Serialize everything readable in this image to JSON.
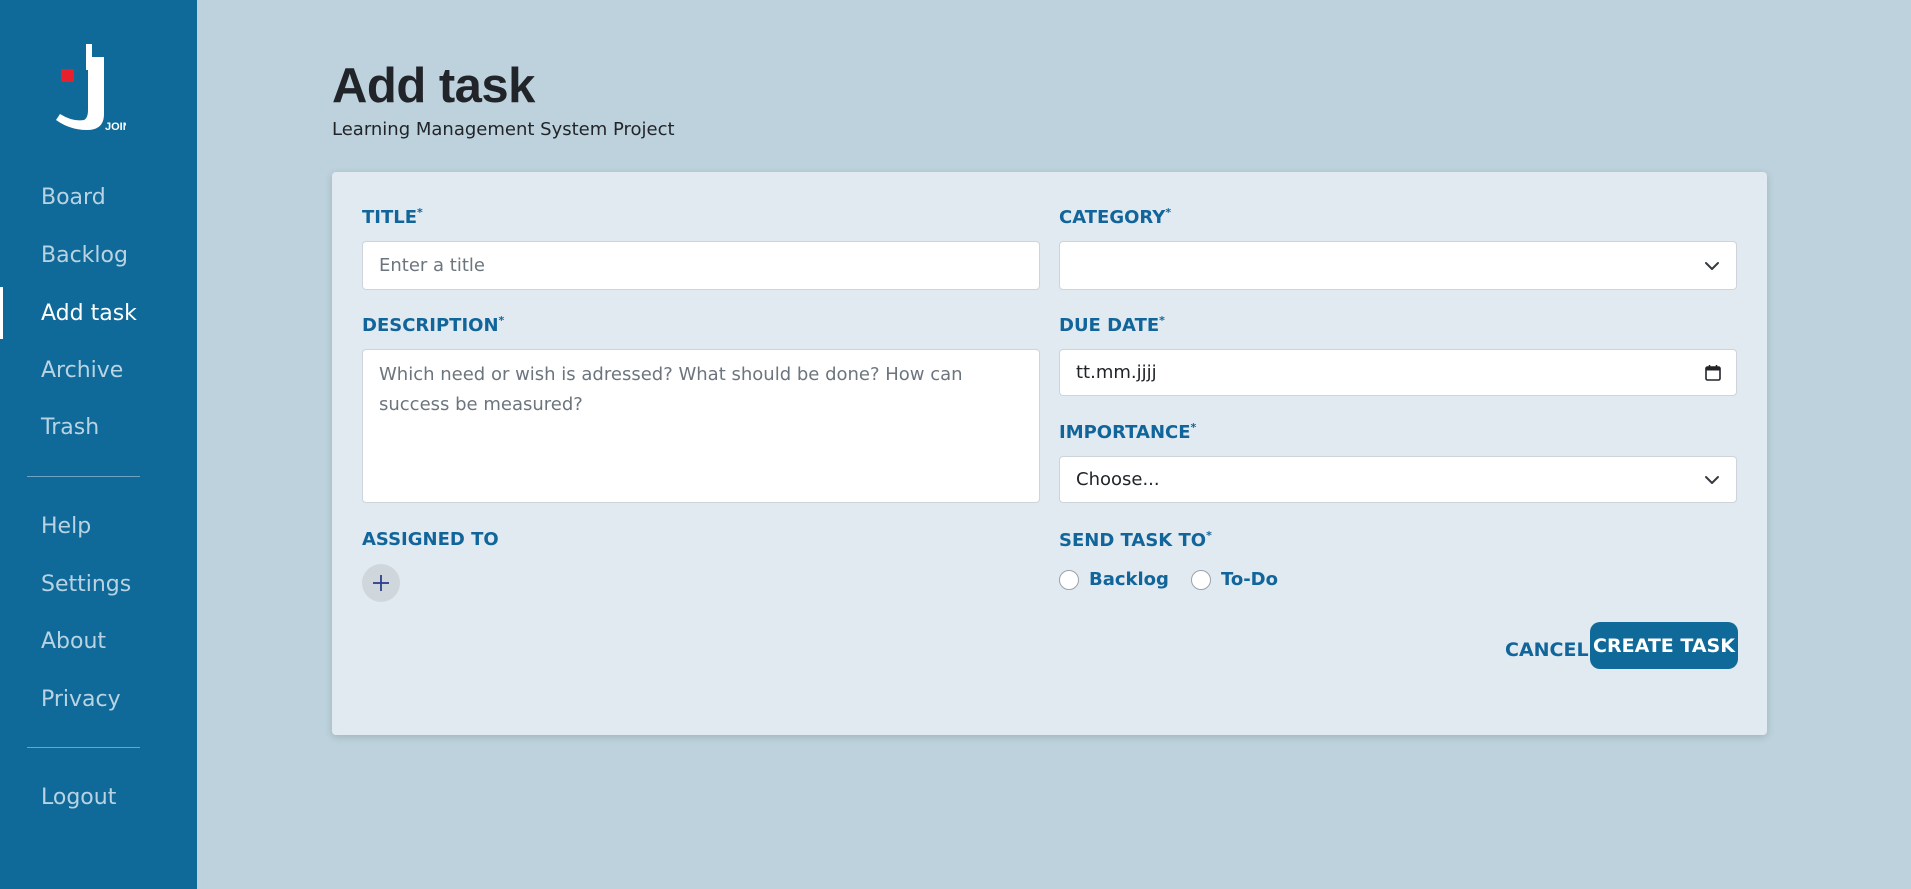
{
  "app": {
    "logo_text": "JOIN"
  },
  "sidebar": {
    "items": [
      {
        "label": "Board"
      },
      {
        "label": "Backlog"
      },
      {
        "label": "Add task",
        "active": true
      },
      {
        "label": "Archive"
      },
      {
        "label": "Trash"
      },
      {
        "label": "Help"
      },
      {
        "label": "Settings"
      },
      {
        "label": "About"
      },
      {
        "label": "Privacy"
      },
      {
        "label": "Logout"
      }
    ]
  },
  "header": {
    "title": "Add task",
    "subtitle": "Learning Management System Project"
  },
  "form": {
    "title": {
      "label": "TITLE",
      "required_mark": "*",
      "placeholder": "Enter a title",
      "value": ""
    },
    "category": {
      "label": "CATEGORY",
      "required_mark": "*",
      "value": ""
    },
    "description": {
      "label": "DESCRIPTION",
      "required_mark": "*",
      "placeholder": "Which need or wish is adressed? What should be done? How can success be measured?",
      "value": ""
    },
    "due_date": {
      "label": "DUE DATE",
      "required_mark": "*",
      "value": "tt.mm.jjjj"
    },
    "importance": {
      "label": "IMPORTANCE",
      "required_mark": "*",
      "value": "Choose..."
    },
    "assigned_to": {
      "label": "ASSIGNED TO"
    },
    "send_task_to": {
      "label": "SEND TASK TO",
      "required_mark": "*",
      "options": [
        {
          "label": "Backlog"
        },
        {
          "label": "To-Do"
        }
      ]
    },
    "cancel_label": "CANCEL",
    "create_label": "CREATE TASK"
  },
  "colors": {
    "sidebar_bg": "#0f6a9a",
    "page_bg": "#bdd2dd",
    "card_bg": "#e1eaf0",
    "accent": "#11659a"
  }
}
